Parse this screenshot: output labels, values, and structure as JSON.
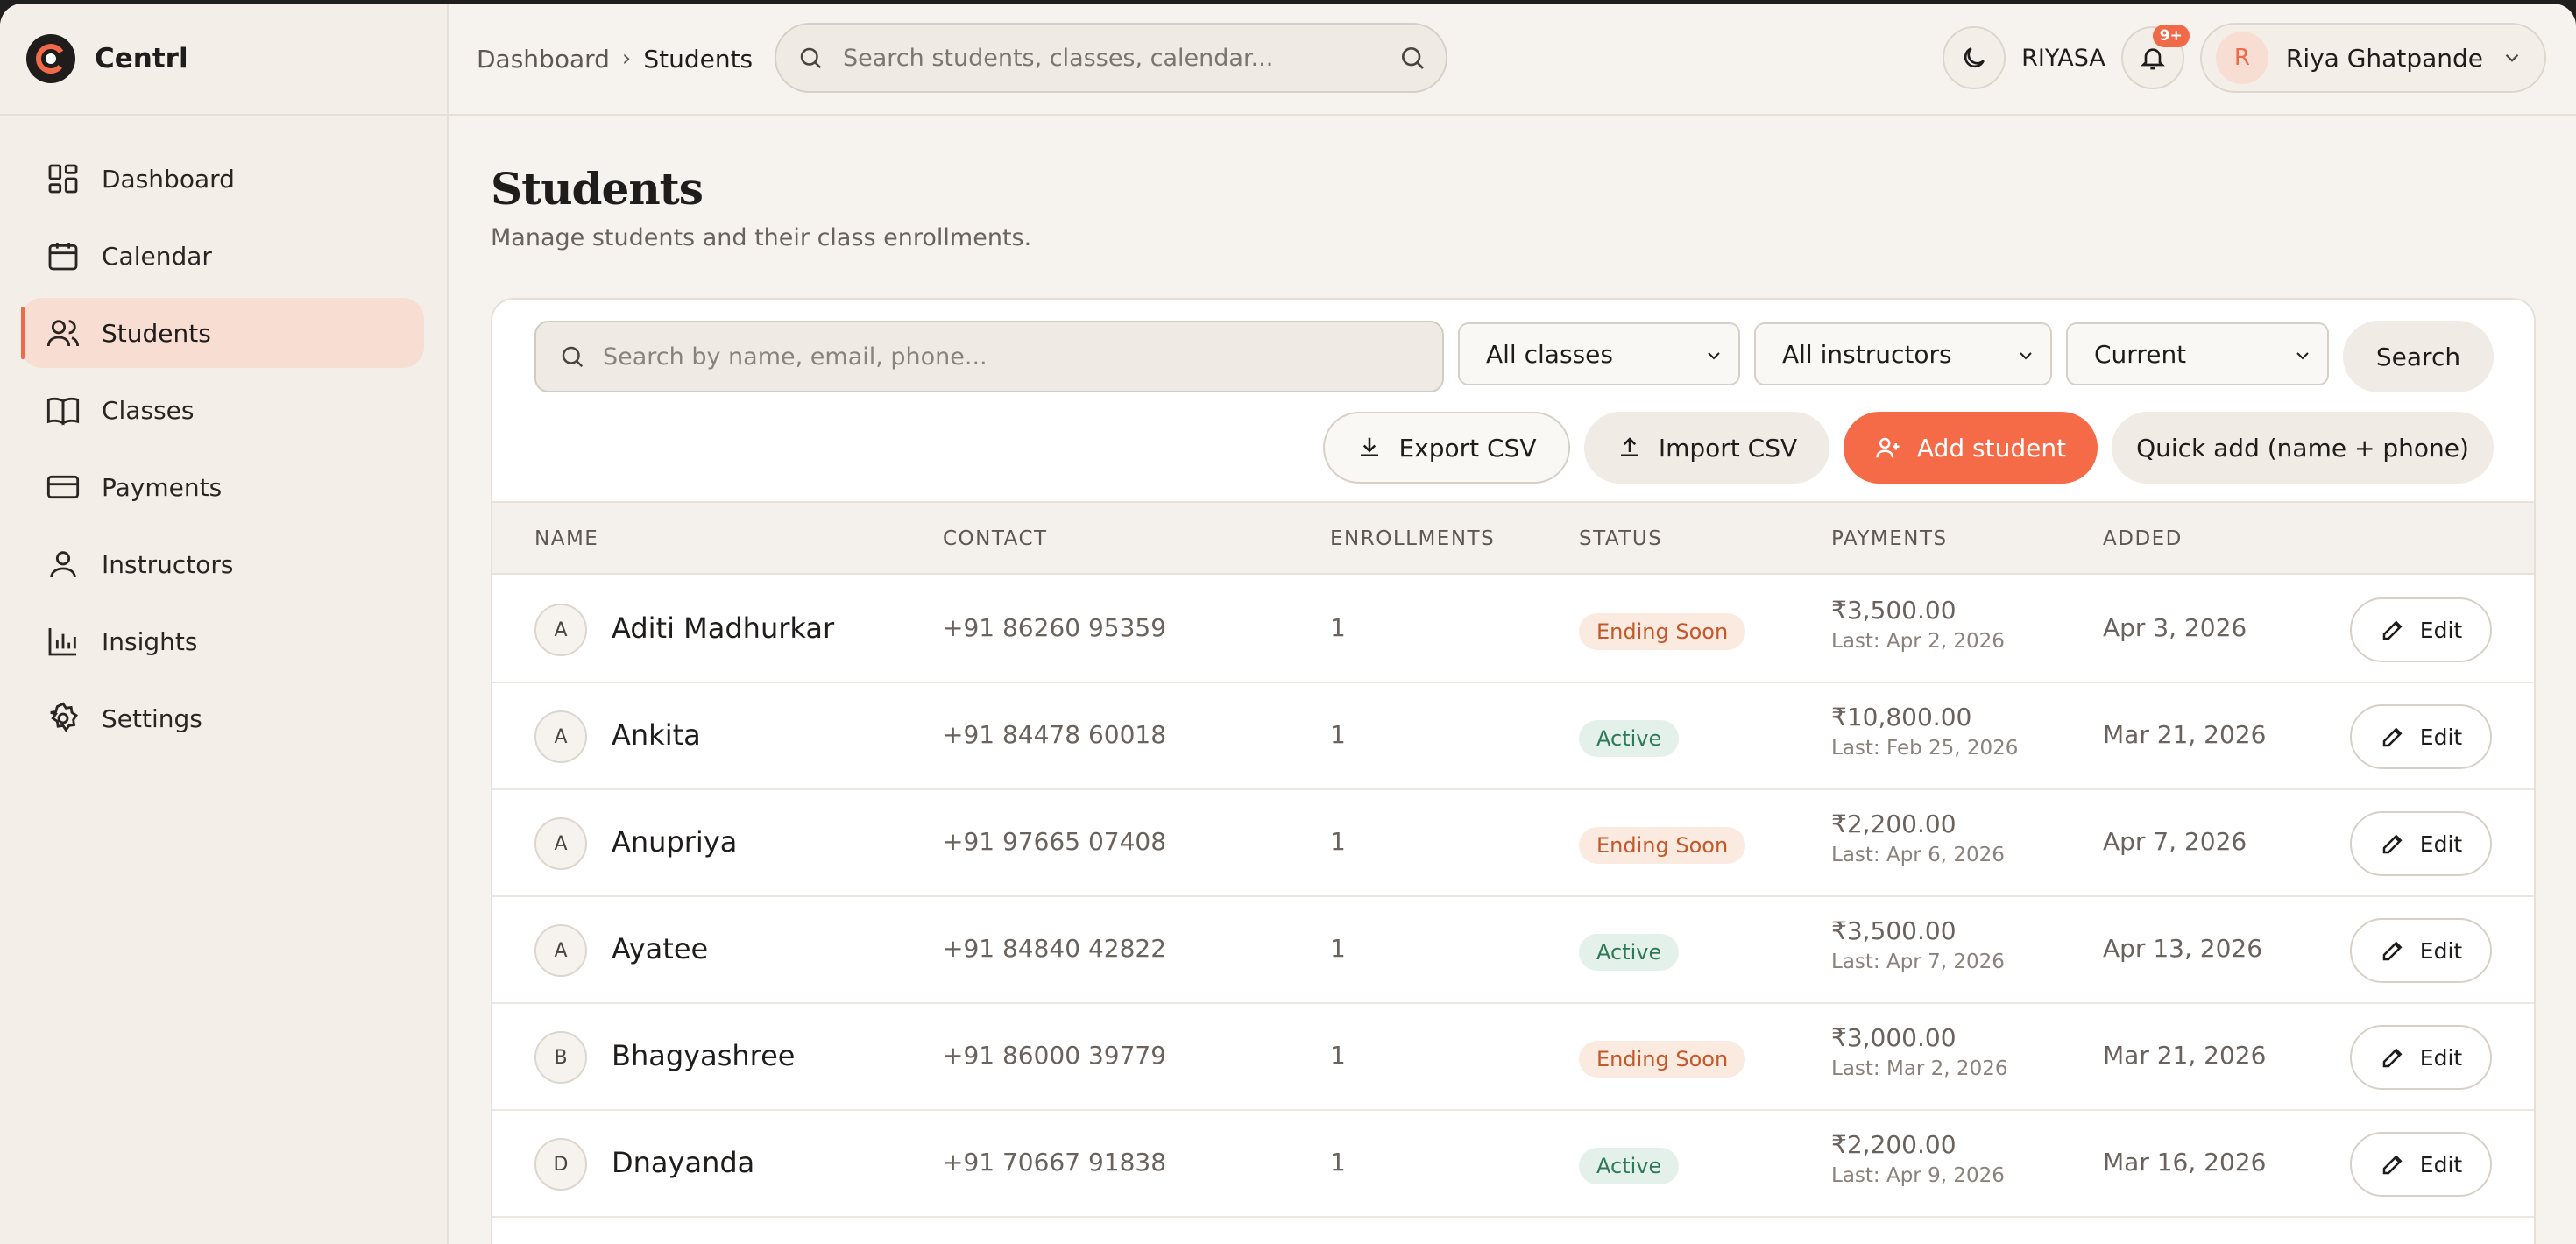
{
  "app": {
    "name": "Centrl"
  },
  "sidebar": {
    "items": [
      {
        "label": "Dashboard",
        "icon": "dashboard-icon"
      },
      {
        "label": "Calendar",
        "icon": "calendar-icon"
      },
      {
        "label": "Students",
        "icon": "users-icon",
        "active": true
      },
      {
        "label": "Classes",
        "icon": "book-icon"
      },
      {
        "label": "Payments",
        "icon": "credit-card-icon"
      },
      {
        "label": "Instructors",
        "icon": "user-icon"
      },
      {
        "label": "Insights",
        "icon": "bar-chart-icon"
      },
      {
        "label": "Settings",
        "icon": "gear-icon"
      }
    ]
  },
  "header": {
    "breadcrumb": [
      "Dashboard",
      "Students"
    ],
    "search_placeholder": "Search students, classes, calendar...",
    "org": "RIYASA",
    "notification_badge": "9+",
    "user": {
      "initial": "R",
      "name": "Riya Ghatpande"
    }
  },
  "page": {
    "title": "Students",
    "subtitle": "Manage students and their class enrollments."
  },
  "filters": {
    "search_placeholder": "Search by name, email, phone...",
    "class_select": "All classes",
    "instructor_select": "All instructors",
    "period_select": "Current",
    "search_button": "Search"
  },
  "actions": {
    "export": "Export CSV",
    "import": "Import CSV",
    "add": "Add student",
    "quick_add": "Quick add (name + phone)"
  },
  "table": {
    "columns": [
      "NAME",
      "CONTACT",
      "ENROLLMENTS",
      "STATUS",
      "PAYMENTS",
      "ADDED"
    ],
    "edit_label": "Edit",
    "rows": [
      {
        "initial": "A",
        "name": "Aditi Madhurkar",
        "contact": "+91 86260 95359",
        "enrollments": "1",
        "status": "Ending Soon",
        "status_type": "soon",
        "amount": "₹3,500.00",
        "last": "Last: Apr 2, 2026",
        "added": "Apr 3, 2026"
      },
      {
        "initial": "A",
        "name": "Ankita",
        "contact": "+91 84478 60018",
        "enrollments": "1",
        "status": "Active",
        "status_type": "active",
        "amount": "₹10,800.00",
        "last": "Last: Feb 25, 2026",
        "added": "Mar 21, 2026"
      },
      {
        "initial": "A",
        "name": "Anupriya",
        "contact": "+91 97665 07408",
        "enrollments": "1",
        "status": "Ending Soon",
        "status_type": "soon",
        "amount": "₹2,200.00",
        "last": "Last: Apr 6, 2026",
        "added": "Apr 7, 2026"
      },
      {
        "initial": "A",
        "name": "Ayatee",
        "contact": "+91 84840 42822",
        "enrollments": "1",
        "status": "Active",
        "status_type": "active",
        "amount": "₹3,500.00",
        "last": "Last: Apr 7, 2026",
        "added": "Apr 13, 2026"
      },
      {
        "initial": "B",
        "name": "Bhagyashree",
        "contact": "+91 86000 39779",
        "enrollments": "1",
        "status": "Ending Soon",
        "status_type": "soon",
        "amount": "₹3,000.00",
        "last": "Last: Mar 2, 2026",
        "added": "Mar 21, 2026"
      },
      {
        "initial": "D",
        "name": "Dnayanda",
        "contact": "+91 70667 91838",
        "enrollments": "1",
        "status": "Active",
        "status_type": "active",
        "amount": "₹2,200.00",
        "last": "Last: Apr 9, 2026",
        "added": "Mar 16, 2026"
      }
    ]
  },
  "colors": {
    "accent": "#f56b48",
    "active_nav": "#f8ddd3",
    "status_soon": "#c5572c",
    "status_active": "#2e7a56"
  }
}
